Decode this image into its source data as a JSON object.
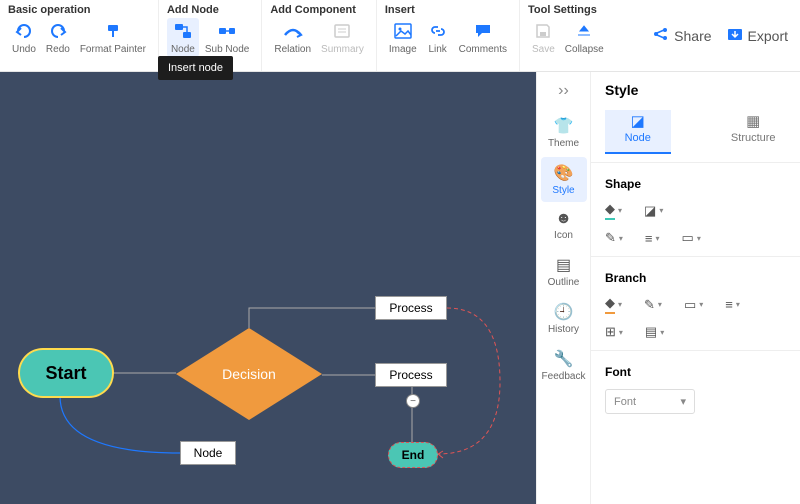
{
  "toolbar": {
    "groups": {
      "basic": {
        "title": "Basic operation",
        "undo": "Undo",
        "redo": "Redo",
        "format_painter": "Format Painter"
      },
      "add_node": {
        "title": "Add Node",
        "node": "Node",
        "sub_node": "Sub Node"
      },
      "add_component": {
        "title": "Add Component",
        "relation": "Relation",
        "summary": "Summary"
      },
      "insert": {
        "title": "Insert",
        "image": "Image",
        "link": "Link",
        "comments": "Comments"
      },
      "tool_settings": {
        "title": "Tool Settings",
        "save": "Save",
        "collapse": "Collapse"
      }
    },
    "share": "Share",
    "export": "Export",
    "tooltip": "Insert node"
  },
  "canvas": {
    "start": "Start",
    "decision": "Decision",
    "process1": "Process",
    "process2": "Process",
    "node": "Node",
    "end": "End"
  },
  "rail": {
    "theme": "Theme",
    "style": "Style",
    "icon": "Icon",
    "outline": "Outline",
    "history": "History",
    "feedback": "Feedback"
  },
  "panel": {
    "title": "Style",
    "tabs": {
      "node": "Node",
      "structure": "Structure"
    },
    "shape": "Shape",
    "branch": "Branch",
    "font": "Font",
    "font_value": "Font"
  }
}
